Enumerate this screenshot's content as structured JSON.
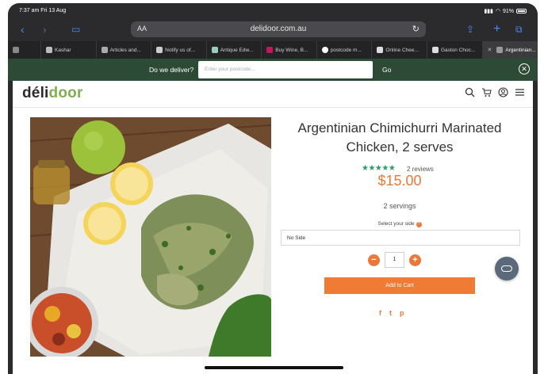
{
  "status": {
    "time_date": "7:37 am   Fri 13 Aug",
    "battery": "91%"
  },
  "browser": {
    "text_size": "AA",
    "url": "delidoor.com.au",
    "tabs": [
      {
        "label": ""
      },
      {
        "label": "Kashar"
      },
      {
        "label": "Articles and..."
      },
      {
        "label": "Notify us of..."
      },
      {
        "label": "Antique Edw..."
      },
      {
        "label": "Buy Wine, B..."
      },
      {
        "label": "postcode m..."
      },
      {
        "label": "Online Chee..."
      },
      {
        "label": "Gaston Choc..."
      },
      {
        "label": "Argentinian..."
      }
    ]
  },
  "banner": {
    "label": "Do we deliver?",
    "postcode_placeholder": "Enter your postcode...",
    "go": "Go"
  },
  "site": {
    "logo_part1": "déli",
    "logo_part2": "door"
  },
  "product": {
    "title": "Argentinian Chimichurri Marinated Chicken, 2 serves",
    "rating_stars": "★★★★★",
    "reviews": "2 reviews",
    "price": "$15.00",
    "servings": "2 servings",
    "side_label": "Select your side",
    "side_value": "No Side",
    "quantity": "1",
    "add_to_cart": "Add to Cart"
  },
  "colors": {
    "accent": "#ef7b35",
    "brand_green": "#7fb04f",
    "banner": "#2d4a36"
  }
}
